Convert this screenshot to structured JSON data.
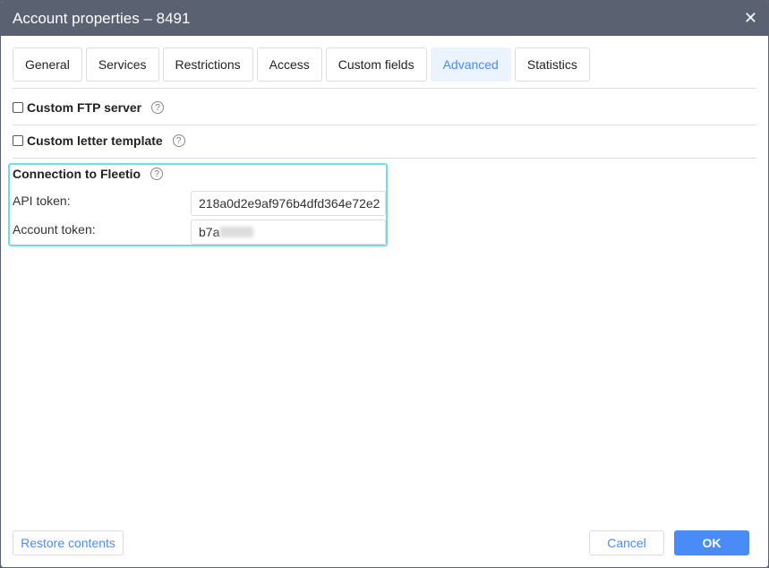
{
  "title": "Account properties – 8491",
  "tabs": [
    "General",
    "Services",
    "Restrictions",
    "Access",
    "Custom fields",
    "Advanced",
    "Statistics"
  ],
  "active_tab": "Advanced",
  "ftp": {
    "label": "Custom FTP server",
    "checked": false
  },
  "letter": {
    "label": "Custom letter template",
    "checked": false
  },
  "fleetio": {
    "title": "Connection to Fleetio",
    "api_label": "API token:",
    "api_value": "218a0d2e9af976b4dfd364e72e2",
    "account_label": "Account token:",
    "account_value": "b7a"
  },
  "help": "?",
  "close": "✕",
  "footer": {
    "restore": "Restore contents",
    "cancel": "Cancel",
    "ok": "OK"
  }
}
